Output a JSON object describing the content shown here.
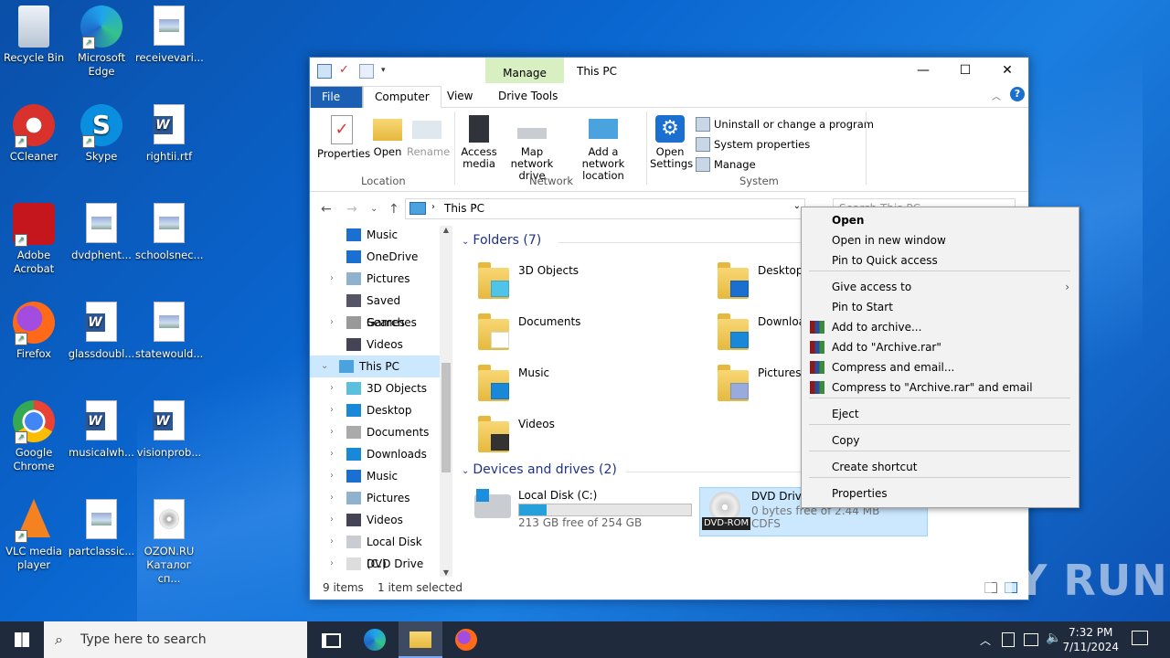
{
  "desktop": {
    "icons": [
      {
        "label": "Recycle Bin"
      },
      {
        "label": "Microsoft Edge"
      },
      {
        "label": "receivevari..."
      },
      {
        "label": "CCleaner"
      },
      {
        "label": "Skype"
      },
      {
        "label": "rightii.rtf"
      },
      {
        "label": "Adobe Acrobat"
      },
      {
        "label": "dvdphent..."
      },
      {
        "label": "schoolsnec..."
      },
      {
        "label": "Firefox"
      },
      {
        "label": "glassdoubl..."
      },
      {
        "label": "statewould..."
      },
      {
        "label": "Google Chrome"
      },
      {
        "label": "musicalwh..."
      },
      {
        "label": "visionprob..."
      },
      {
        "label": "VLC media player"
      },
      {
        "label": "partclassic..."
      },
      {
        "label": "OZON.RU Каталог сп..."
      }
    ]
  },
  "explorer": {
    "title": "This PC",
    "manage_tab": "Manage",
    "tabs": [
      "File",
      "Computer",
      "View",
      "Drive Tools"
    ],
    "ribbon": {
      "properties": "Properties",
      "open": "Open",
      "rename": "Rename",
      "location_group": "Location",
      "access_media": "Access media",
      "map_network_drive": "Map network drive",
      "add_network_location": "Add a network location",
      "network_group": "Network",
      "open_settings": "Open Settings",
      "uninstall": "Uninstall or change a program",
      "system_properties": "System properties",
      "manage": "Manage",
      "system_group": "System"
    },
    "address": {
      "path": "This PC",
      "search_placeholder": "Search This PC"
    },
    "tree": [
      {
        "label": "Music",
        "chev": ""
      },
      {
        "label": "OneDrive",
        "chev": ""
      },
      {
        "label": "Pictures",
        "chev": ">"
      },
      {
        "label": "Saved Games",
        "chev": ""
      },
      {
        "label": "Searches",
        "chev": ">"
      },
      {
        "label": "Videos",
        "chev": ""
      },
      {
        "label": "This PC",
        "chev": "v"
      },
      {
        "label": "3D Objects",
        "chev": ">"
      },
      {
        "label": "Desktop",
        "chev": ">"
      },
      {
        "label": "Documents",
        "chev": ">"
      },
      {
        "label": "Downloads",
        "chev": ">"
      },
      {
        "label": "Music",
        "chev": ">"
      },
      {
        "label": "Pictures",
        "chev": ">"
      },
      {
        "label": "Videos",
        "chev": ">"
      },
      {
        "label": "Local Disk (C:)",
        "chev": ">"
      },
      {
        "label": "DVD Drive (D:)",
        "chev": ">"
      }
    ],
    "folders_header": "Folders (7)",
    "folders": [
      "3D Objects",
      "Desktop",
      "Documents",
      "Downloads",
      "Music",
      "Pictures",
      "Videos"
    ],
    "devices_header": "Devices and drives (2)",
    "drives": [
      {
        "name": "Local Disk (C:)",
        "free": "213 GB free of 254 GB",
        "used_fraction": 0.16
      },
      {
        "name": "DVD Drive",
        "free": "0 bytes free of 2.44 MB",
        "fs": "CDFS",
        "badge": "DVD-ROM"
      }
    ],
    "status": {
      "items": "9 items",
      "selected": "1 item selected"
    }
  },
  "context_menu": {
    "items": [
      {
        "label": "Open",
        "bold": true
      },
      {
        "label": "Open in new window"
      },
      {
        "label": "Pin to Quick access"
      },
      {
        "label": "Give access to",
        "submenu": true
      },
      {
        "label": "Pin to Start"
      },
      {
        "label": "Add to archive...",
        "icon": "winrar-icon"
      },
      {
        "label": "Add to \"Archive.rar\"",
        "icon": "winrar-icon"
      },
      {
        "label": "Compress and email...",
        "icon": "winrar-icon"
      },
      {
        "label": "Compress to \"Archive.rar\" and email",
        "icon": "winrar-icon"
      },
      {
        "label": "Eject"
      },
      {
        "label": "Copy"
      },
      {
        "label": "Create shortcut"
      },
      {
        "label": "Properties"
      }
    ]
  },
  "taskbar": {
    "search_placeholder": "Type here to search",
    "time": "7:32 PM",
    "date": "7/11/2024"
  },
  "watermark": "ANY RUN",
  "colors": {
    "accent": "#1a5fb4",
    "selection": "#cce8ff",
    "manage_tab": "#d8efc2"
  }
}
